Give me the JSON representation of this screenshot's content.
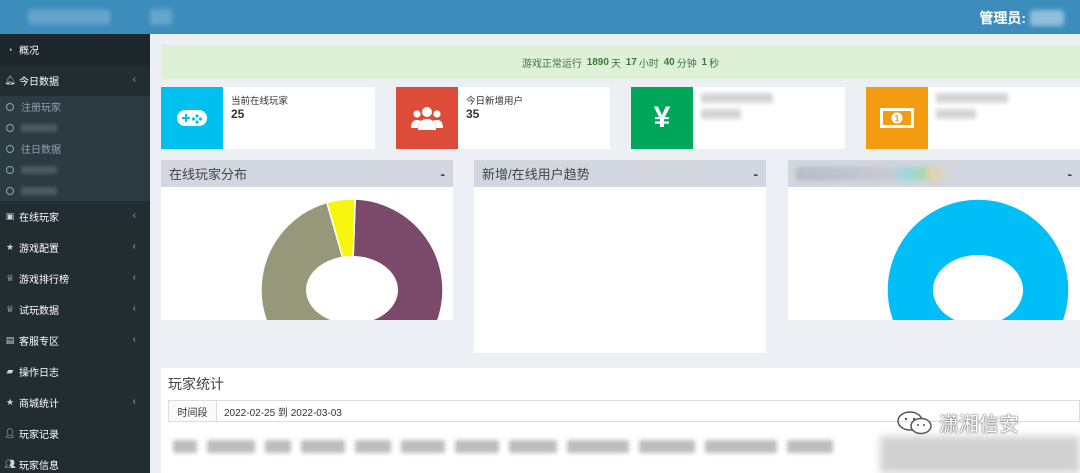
{
  "header": {
    "admin_label": "管理员:"
  },
  "sidebar": {
    "overview": "概况",
    "today": "今日数据",
    "today_subs": [
      "注册玩家",
      "",
      "往日数据",
      "",
      ""
    ],
    "items": [
      "在线玩家",
      "游戏配置",
      "游戏排行榜",
      "试玩数据",
      "客服专区",
      "操作日志",
      "商城统计",
      "玩家记录",
      "玩家信息"
    ]
  },
  "notice": {
    "prefix": "游戏正常运行",
    "days": "1890",
    "days_unit": "天",
    "hours": "17",
    "hours_unit": "小时",
    "minutes": "40",
    "minutes_unit": "分钟",
    "seconds": "1",
    "seconds_unit": "秒"
  },
  "info_boxes": [
    {
      "label": "当前在线玩家",
      "value": "25",
      "color": "#00c0ef",
      "icon": "gamepad-icon"
    },
    {
      "label": "今日新增用户",
      "value": "35",
      "color": "#dd4b39",
      "icon": "users-icon"
    },
    {
      "label": "",
      "value": "",
      "color": "#00a65a",
      "icon": "yen-icon"
    },
    {
      "label": "",
      "value": "",
      "color": "#f39c12",
      "icon": "money-icon"
    }
  ],
  "panels": {
    "distribution_title": "在线玩家分布",
    "trend_title": "新增/在线用户趋势",
    "collapse": "-"
  },
  "chart_data": [
    {
      "type": "pie",
      "title": "在线玩家分布",
      "values": [
        0.58,
        0.37,
        0.05
      ],
      "colors": [
        "#7b4a6a",
        "#979779",
        "#f7f40d"
      ]
    },
    {
      "type": "pie",
      "title": "",
      "values": [
        1.0
      ],
      "colors": [
        "#00bff8"
      ]
    }
  ],
  "stats": {
    "title": "玩家统计",
    "range_label": "时间段",
    "range_value": "2022-02-25 到 2022-03-03"
  },
  "watermark": {
    "text": "潇湘信安"
  }
}
